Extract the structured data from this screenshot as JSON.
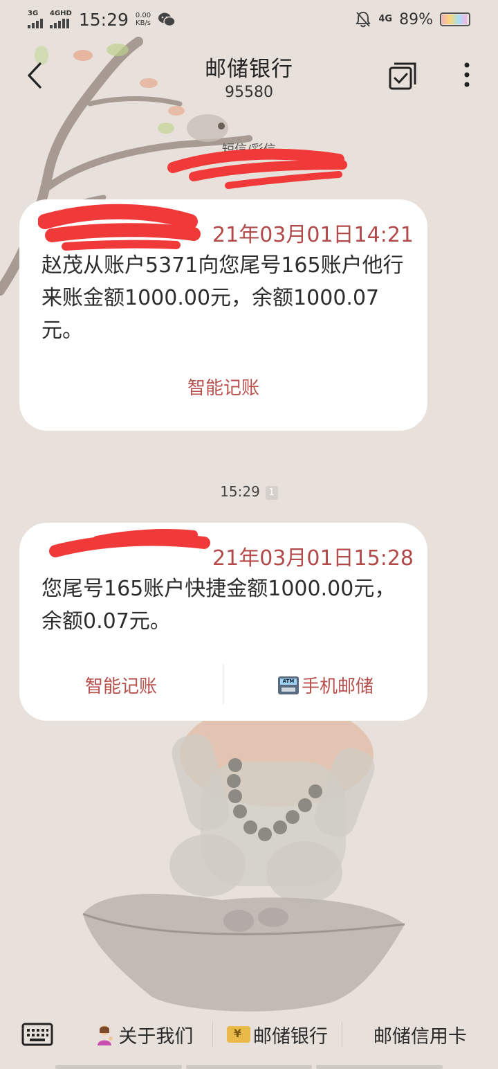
{
  "status_bar": {
    "signal1_label": "3G",
    "signal2_label": "4GHD",
    "time": "15:29",
    "net_speed_value": "0.00",
    "net_speed_unit": "KB/s",
    "net_4g_label": "4G",
    "battery_percent": "89%",
    "battery_level": 0.89
  },
  "header": {
    "title": "邮储银行",
    "number": "95580"
  },
  "thread": {
    "type_label": "短信/彩信",
    "messages": [
      {
        "head_visible": "21年03月01日14:21",
        "body": "赵茂从账户5371向您尾号165账户他行来账金额1000.00元，余额1000.07元。",
        "action_label": "智能记账"
      },
      {
        "head_visible": "21年03月01日15:28",
        "body": "您尾号165账户快捷金额1000.00元，余额0.07元。",
        "action_left_label": "智能记账",
        "action_right_label": "手机邮储",
        "atm_icon_text": "ATM"
      }
    ],
    "timestamp": "15:29",
    "sim_badge": "1"
  },
  "bottom_menu": {
    "items": [
      {
        "label": "关于我们",
        "icon": "person-tipping-hand-icon"
      },
      {
        "label": "邮储银行",
        "icon": "coin-icon"
      },
      {
        "label": "邮储信用卡"
      }
    ]
  },
  "colors": {
    "accent": "#b7514d",
    "background": "#e7e0db",
    "redaction": "#f03a3a"
  }
}
